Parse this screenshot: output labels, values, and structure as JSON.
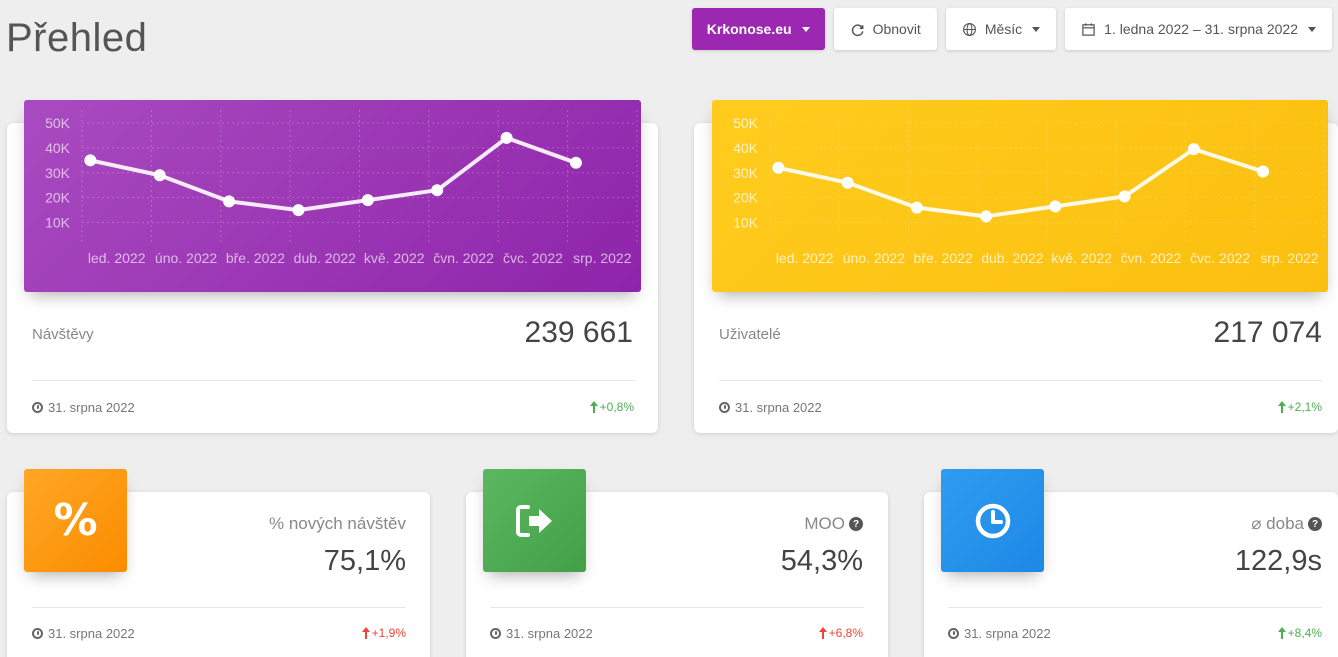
{
  "page_title": "Přehled",
  "toolbar": {
    "site_label": "Krkonose.eu",
    "refresh_label": "Obnovit",
    "period_label": "Měsíc",
    "date_range_label": "1. ledna 2022 – 31. srpna 2022"
  },
  "colors": {
    "purple": "#9c27b0",
    "amber": "#ffc107",
    "orange": "#ff9800",
    "green": "#4caf50",
    "blue": "#2196f3"
  },
  "visits": {
    "title": "Návštěvy",
    "value": "239 661",
    "date": "31. srpna 2022",
    "change": "+0,8%"
  },
  "users": {
    "title": "Uživatelé",
    "value": "217 074",
    "date": "31. srpna 2022",
    "change": "+2,1%"
  },
  "new_visits": {
    "icon": "percent-icon",
    "title": "% nových návštěv",
    "value": "75,1%",
    "date": "31. srpna 2022",
    "change": "+1,9%"
  },
  "bounce": {
    "icon": "sign-out-icon",
    "title": "MOO",
    "value": "54,3%",
    "date": "31. srpna 2022",
    "change": "+6,8%"
  },
  "avg_time": {
    "icon": "clock-icon",
    "title": "⌀ doba",
    "value": "122,9s",
    "date": "31. srpna 2022",
    "change": "+8,4%"
  },
  "chart_data": [
    {
      "type": "line",
      "categories": [
        "led. 2022",
        "úno. 2022",
        "bře. 2022",
        "dub. 2022",
        "kvě. 2022",
        "čvn. 2022",
        "čvc. 2022",
        "srp. 2022"
      ],
      "values": [
        35000,
        29000,
        18500,
        15000,
        19000,
        23000,
        44000,
        34000
      ],
      "yticks": [
        "50K",
        "40K",
        "30K",
        "20K",
        "10K"
      ],
      "ylim": [
        5000,
        52000
      ],
      "grid": true
    },
    {
      "type": "line",
      "categories": [
        "led. 2022",
        "úno. 2022",
        "bře. 2022",
        "dub. 2022",
        "kvě. 2022",
        "čvn. 2022",
        "čvc. 2022",
        "srp. 2022"
      ],
      "values": [
        32000,
        26000,
        16000,
        12500,
        16500,
        20500,
        39500,
        30500
      ],
      "yticks": [
        "50K",
        "40K",
        "30K",
        "20K",
        "10K"
      ],
      "ylim": [
        5000,
        52000
      ],
      "grid": true
    }
  ]
}
